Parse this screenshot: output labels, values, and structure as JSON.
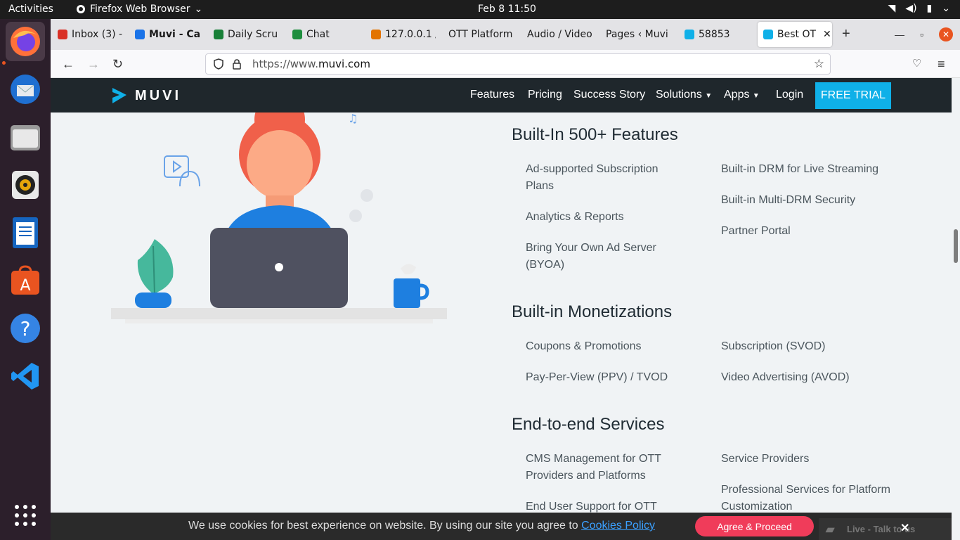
{
  "topbar": {
    "activities": "Activities",
    "app_name": "Firefox Web Browser",
    "clock": "Feb 8  11:50"
  },
  "tabs": [
    {
      "label": "Inbox (3) -",
      "color": "#d93025"
    },
    {
      "label": "Muvi - Cal",
      "color": "#1a73e8"
    },
    {
      "label": "Daily Scru",
      "color": "#188038"
    },
    {
      "label": "Chat",
      "color": "#1e8e3e"
    },
    {
      "label": "127.0.0.1 /",
      "color": "#e37400"
    },
    {
      "label": "OTT Platform",
      "color": ""
    },
    {
      "label": "Audio / Video",
      "color": ""
    },
    {
      "label": "Pages ‹ Muvi",
      "color": ""
    },
    {
      "label": "58853",
      "color": "#0fb0e8"
    },
    {
      "label": "Best OT",
      "color": "#0fb0e8"
    }
  ],
  "urlbar": {
    "prefix": "https://www.",
    "domain": "muvi.com"
  },
  "site": {
    "logo": "MUVI",
    "menu": [
      "Features",
      "Pricing",
      "Success Story",
      "Solutions",
      "Apps",
      "Login"
    ],
    "trial": "FREE TRIAL",
    "accent": "#0fb0e8"
  },
  "sections": {
    "features": {
      "title": "Built-In 500+ Features",
      "left": [
        "Ad-supported Subscription Plans",
        "Analytics & Reports",
        "Bring Your Own Ad Server (BYOA)"
      ],
      "right": [
        "Built-in DRM for Live Streaming",
        "Built-in Multi-DRM Security",
        "Partner Portal"
      ]
    },
    "monetizations": {
      "title": "Built-in Monetizations",
      "left": [
        "Coupons & Promotions",
        "Pay-Per-View (PPV) / TVOD"
      ],
      "right": [
        "Subscription (SVOD)",
        "Video Advertising (AVOD)"
      ]
    },
    "services": {
      "title": "End-to-end Services",
      "left": [
        "CMS Management for OTT Providers and Platforms",
        "End User Support for OTT"
      ],
      "right": [
        "Service Providers",
        "Professional Services for Platform Customization"
      ]
    }
  },
  "cookie": {
    "message": "We use cookies for best experience on website. By using our site you agree to ",
    "link": "Cookies Policy",
    "agree": "Agree & Proceed",
    "chat": "Live - Talk to us"
  }
}
